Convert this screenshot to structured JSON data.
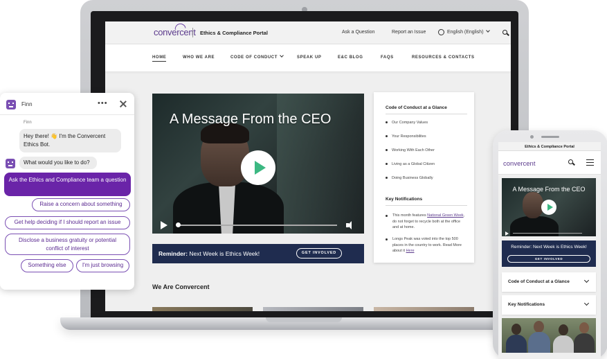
{
  "site": {
    "logo": "convercent",
    "portal_title": "Ethics & Compliance Portal",
    "top_links": {
      "ask": "Ask a Question",
      "report": "Report an Issue",
      "language": "English (English)"
    },
    "nav": [
      "HOME",
      "WHO WE ARE",
      "CODE OF CONDUCT",
      "SPEAK UP",
      "E&C BLOG",
      "FAQS",
      "RESOURCES & CONTACTS"
    ],
    "hero_title": "A Message From the CEO",
    "reminder": {
      "bold": "Reminder:",
      "text": "Next Week is Ethics Week!",
      "button": "GET INVOLVED"
    },
    "sidebar": {
      "code_heading": "Code of Conduct at a Glance",
      "code_items": [
        "Our Company Values",
        "Your Responsibilites",
        "Working With Each Other",
        "Living as a Global Citizen",
        "Doing Business Globally"
      ],
      "notif_heading": "Key Notifications",
      "notif1": {
        "a": "This month features ",
        "link": "National Green Week",
        "b": ", do not forget to recycle both at the office and at home."
      },
      "notif2": {
        "a": "Longs Peak was voted into the top 500 places in the country to work. Read More about it ",
        "link": "Here"
      }
    },
    "section_title": "We Are Convercent"
  },
  "chat": {
    "bot_name": "Finn",
    "sender": "Finn",
    "greeting": "Hey there! 👋 I'm the Convercent Ethics Bot.",
    "question": "What would you like to do?",
    "primary_option": "Ask the Ethics and Compliance team a question",
    "options": [
      "Raise a concern about something",
      "Get help deciding if I should report an issue",
      "Disclose a business gratuity or potential conflict of interest",
      "Something else",
      "I'm just browsing"
    ]
  },
  "phone": {
    "portal_title": "Ethics & Compliance Portal",
    "logo": "convercent",
    "hero_title": "A Message From the CEO",
    "reminder": "Reminder: Next Week is Ethics Week!",
    "button": "GET INVOLVED",
    "accordion": [
      "Code of Conduct at a Glance",
      "Key Notifications"
    ]
  },
  "colors": {
    "brand_purple": "#6a24a8",
    "navy": "#1f2c4f",
    "play_green": "#3cb882"
  },
  "icons": [
    "globe-icon",
    "search-icon",
    "chevron-down-icon",
    "play-icon",
    "volume-icon",
    "bot-avatar-icon",
    "more-icon",
    "close-icon",
    "hamburger-menu-icon"
  ]
}
